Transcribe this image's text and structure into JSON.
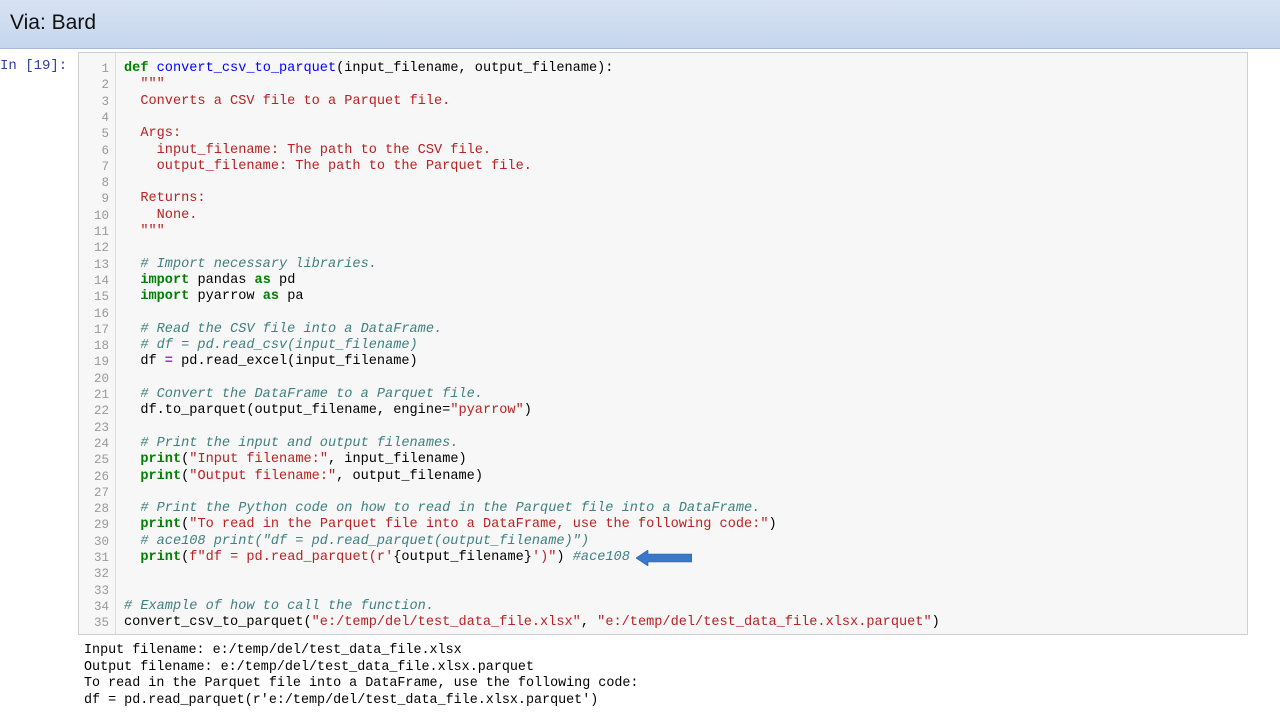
{
  "banner": {
    "title": "Via: Bard"
  },
  "cell": {
    "prompt": "In [19]:",
    "lines": [
      {
        "n": "1",
        "segs": [
          {
            "t": "def ",
            "c": "kw"
          },
          {
            "t": "convert_csv_to_parquet",
            "c": "fn"
          },
          {
            "t": "(input_filename, output_filename):",
            "c": "nm"
          }
        ]
      },
      {
        "n": "2",
        "segs": [
          {
            "t": "  \"\"\"",
            "c": "str"
          }
        ]
      },
      {
        "n": "3",
        "segs": [
          {
            "t": "  Converts a CSV file to a Parquet file.",
            "c": "str"
          }
        ]
      },
      {
        "n": "4",
        "segs": []
      },
      {
        "n": "5",
        "segs": [
          {
            "t": "  Args:",
            "c": "str"
          }
        ]
      },
      {
        "n": "6",
        "segs": [
          {
            "t": "    input_filename: The path to the CSV file.",
            "c": "str"
          }
        ]
      },
      {
        "n": "7",
        "segs": [
          {
            "t": "    output_filename: The path to the Parquet file.",
            "c": "str"
          }
        ]
      },
      {
        "n": "8",
        "segs": []
      },
      {
        "n": "9",
        "segs": [
          {
            "t": "  Returns:",
            "c": "str"
          }
        ]
      },
      {
        "n": "10",
        "segs": [
          {
            "t": "    None.",
            "c": "str"
          }
        ]
      },
      {
        "n": "11",
        "segs": [
          {
            "t": "  \"\"\"",
            "c": "str"
          }
        ]
      },
      {
        "n": "12",
        "segs": []
      },
      {
        "n": "13",
        "segs": [
          {
            "t": "  # Import necessary libraries.",
            "c": "cm"
          }
        ]
      },
      {
        "n": "14",
        "segs": [
          {
            "t": "  ",
            "c": "nm"
          },
          {
            "t": "import",
            "c": "kw"
          },
          {
            "t": " pandas ",
            "c": "nm"
          },
          {
            "t": "as",
            "c": "kw"
          },
          {
            "t": " pd",
            "c": "nm"
          }
        ]
      },
      {
        "n": "15",
        "segs": [
          {
            "t": "  ",
            "c": "nm"
          },
          {
            "t": "import",
            "c": "kw"
          },
          {
            "t": " pyarrow ",
            "c": "nm"
          },
          {
            "t": "as",
            "c": "kw"
          },
          {
            "t": " pa",
            "c": "nm"
          }
        ]
      },
      {
        "n": "16",
        "segs": []
      },
      {
        "n": "17",
        "segs": [
          {
            "t": "  # Read the CSV file into a DataFrame.",
            "c": "cm"
          }
        ]
      },
      {
        "n": "18",
        "segs": [
          {
            "t": "  # df = pd.read_csv(input_filename)",
            "c": "cm"
          }
        ]
      },
      {
        "n": "19",
        "segs": [
          {
            "t": "  df ",
            "c": "nm"
          },
          {
            "t": "=",
            "c": "op"
          },
          {
            "t": " pd.read_excel(input_filename)",
            "c": "nm"
          }
        ]
      },
      {
        "n": "20",
        "segs": []
      },
      {
        "n": "21",
        "segs": [
          {
            "t": "  # Convert the DataFrame to a Parquet file.",
            "c": "cm"
          }
        ]
      },
      {
        "n": "22",
        "segs": [
          {
            "t": "  df.to_parquet(output_filename, engine=",
            "c": "nm"
          },
          {
            "t": "\"pyarrow\"",
            "c": "str"
          },
          {
            "t": ")",
            "c": "nm"
          }
        ]
      },
      {
        "n": "23",
        "segs": []
      },
      {
        "n": "24",
        "segs": [
          {
            "t": "  # Print the input and output filenames.",
            "c": "cm"
          }
        ]
      },
      {
        "n": "25",
        "segs": [
          {
            "t": "  ",
            "c": "nm"
          },
          {
            "t": "print",
            "c": "kw"
          },
          {
            "t": "(",
            "c": "nm"
          },
          {
            "t": "\"Input filename:\"",
            "c": "str"
          },
          {
            "t": ", input_filename)",
            "c": "nm"
          }
        ]
      },
      {
        "n": "26",
        "segs": [
          {
            "t": "  ",
            "c": "nm"
          },
          {
            "t": "print",
            "c": "kw"
          },
          {
            "t": "(",
            "c": "nm"
          },
          {
            "t": "\"Output filename:\"",
            "c": "str"
          },
          {
            "t": ", output_filename)",
            "c": "nm"
          }
        ]
      },
      {
        "n": "27",
        "segs": []
      },
      {
        "n": "28",
        "segs": [
          {
            "t": "  # Print the Python code on how to read in the Parquet file into a DataFrame.",
            "c": "cm"
          }
        ]
      },
      {
        "n": "29",
        "segs": [
          {
            "t": "  ",
            "c": "nm"
          },
          {
            "t": "print",
            "c": "kw"
          },
          {
            "t": "(",
            "c": "nm"
          },
          {
            "t": "\"To read in the Parquet file into a DataFrame, use the following code:\"",
            "c": "str"
          },
          {
            "t": ")",
            "c": "nm"
          }
        ]
      },
      {
        "n": "30",
        "segs": [
          {
            "t": "  # ace108 print(\"df = pd.read_parquet(output_filename)\")",
            "c": "cm"
          }
        ]
      },
      {
        "n": "31",
        "segs": [
          {
            "t": "  ",
            "c": "nm"
          },
          {
            "t": "print",
            "c": "kw"
          },
          {
            "t": "(",
            "c": "nm"
          },
          {
            "t": "f\"df = pd.read_parquet(r'",
            "c": "str"
          },
          {
            "t": "{output_filename}",
            "c": "nm"
          },
          {
            "t": "')\"",
            "c": "str"
          },
          {
            "t": ") ",
            "c": "nm"
          },
          {
            "t": "#ace108",
            "c": "cm"
          }
        ]
      },
      {
        "n": "32",
        "segs": []
      },
      {
        "n": "33",
        "segs": []
      },
      {
        "n": "34",
        "segs": [
          {
            "t": "# Example of how to call the function.",
            "c": "cm"
          }
        ]
      },
      {
        "n": "35",
        "segs": [
          {
            "t": "convert_csv_to_parquet(",
            "c": "nm"
          },
          {
            "t": "\"e:/temp/del/test_data_file.xlsx\"",
            "c": "str"
          },
          {
            "t": ", ",
            "c": "nm"
          },
          {
            "t": "\"e:/temp/del/test_data_file.xlsx.parquet\"",
            "c": "str"
          },
          {
            "t": ")",
            "c": "nm"
          }
        ]
      }
    ]
  },
  "output": {
    "lines": [
      "Input filename: e:/temp/del/test_data_file.xlsx",
      "Output filename: e:/temp/del/test_data_file.xlsx.parquet",
      "To read in the Parquet file into a DataFrame, use the following code:",
      "df = pd.read_parquet(r'e:/temp/del/test_data_file.xlsx.parquet')"
    ]
  },
  "annotation": {
    "arrow_icon": "left-arrow-icon",
    "arrow_color": "#3a78c9"
  }
}
